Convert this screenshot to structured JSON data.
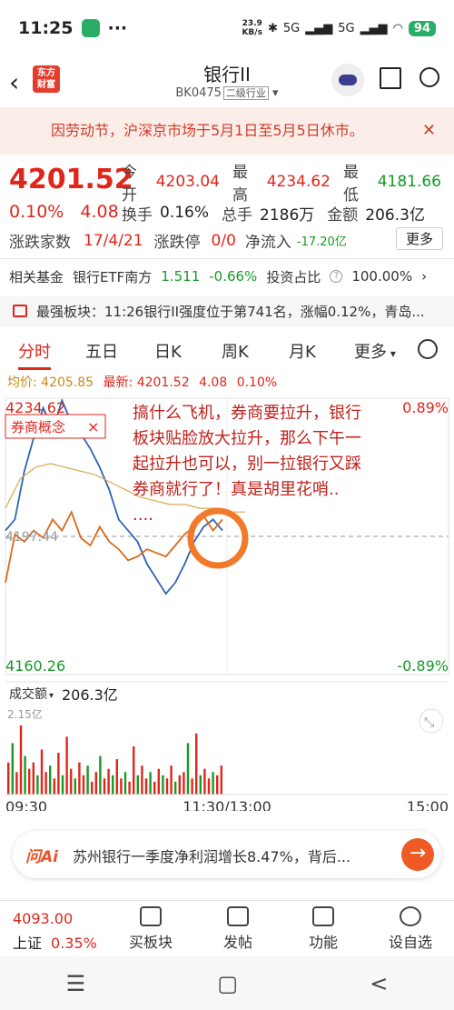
{
  "status_bar": {
    "time": "11:25",
    "more": "···",
    "net_speed_value": "23.9",
    "net_speed_unit": "KB/s",
    "signal1": "5G",
    "signal2": "5G",
    "battery": "94"
  },
  "nav": {
    "logo_line1": "东方",
    "logo_line2": "财富",
    "title": "银行II",
    "code": "BK0475",
    "category": "二级行业"
  },
  "notice": {
    "text": "因劳动节，沪深京市场于5月1日至5月5日休市。"
  },
  "quote": {
    "price": "4201.52",
    "change_pct": "0.10%",
    "change": "4.08",
    "open_label": "今开",
    "open": "4203.04",
    "high_label": "最高",
    "high": "4234.62",
    "low_label": "最低",
    "low": "4181.66",
    "turnover_label": "换手",
    "turnover": "0.16%",
    "volume_label": "总手",
    "volume": "2186万",
    "amount_label": "金额",
    "amount": "206.3亿",
    "updown_label": "涨跌家数",
    "updown": "17/4/21",
    "limit_label": "涨跌停",
    "limit": "0/0",
    "netflow_label": "净流入",
    "netflow": "-17.20亿",
    "more_label": "更多"
  },
  "fund": {
    "label": "相关基金",
    "name": "银行ETF南方",
    "price": "1.511",
    "change": "-0.66%",
    "ratio_label": "投资占比",
    "ratio": "100.00%"
  },
  "strong": {
    "text": "最强板块：11:26银行II强度位于第741名，涨幅0.12%，青岛..."
  },
  "tabs": [
    "分时",
    "五日",
    "日K",
    "周K",
    "月K",
    "更多"
  ],
  "avg": {
    "avg_label": "均价:",
    "avg_value": "4205.85",
    "latest_label": "最新:",
    "latest_value": "4201.52",
    "change": "4.08",
    "pct": "0.10%"
  },
  "chart_data": {
    "type": "line",
    "top_price_label": "4234.62",
    "bottom_price_label": "4160.26",
    "mid_price_label": "4197.44",
    "top_pct_label": "0.89%",
    "bottom_pct_label": "-0.89%",
    "overlay_tag": "券商概念",
    "overlay_close": "×",
    "annotation": "搞什么飞机，券商要拉升，银行板块贴脸放大拉升，那么下午一起拉升也可以，别一拉银行又踩券商就行了！真是胡里花哨......",
    "volume_label": "成交额",
    "volume_total": "206.3亿",
    "volume_max_label": "2.15亿",
    "time_labels": [
      "09:30",
      "11:30/13:00",
      "15:00"
    ],
    "ylim": [
      4160.26,
      4234.62
    ],
    "series": [
      {
        "values": [
          4199,
          4202,
          4215,
          4224,
          4232,
          4226,
          4234,
          4228,
          4225,
          4221,
          4216,
          4210,
          4202,
          4199,
          4196,
          4190,
          4186,
          4182,
          4185,
          4190,
          4196,
          4200,
          4202,
          4199
        ]
      },
      {
        "values": [
          4185,
          4198,
          4196,
          4199,
          4197,
          4202,
          4199,
          4204,
          4197,
          4195,
          4200,
          4196,
          4194,
          4191,
          4192,
          4194,
          4193,
          4192,
          4195,
          4198,
          4200,
          4203,
          4199,
          4202
        ]
      },
      {
        "values": [
          4205,
          4213,
          4216,
          4217,
          4216,
          4215,
          4214,
          4212,
          4210,
          4208,
          4207,
          4206,
          4206,
          4205,
          4205,
          4204,
          4204
        ]
      }
    ],
    "volume": [
      1.0,
      1.6,
      0.7,
      2.15,
      1.2,
      0.8,
      1.0,
      0.6,
      1.4,
      0.7,
      0.9,
      0.5,
      1.3,
      0.6,
      1.8,
      0.8,
      0.5,
      1.0,
      0.6,
      0.9,
      0.4,
      0.7,
      1.2,
      0.5,
      0.8,
      0.6,
      1.1,
      0.5,
      0.7,
      0.4,
      1.5,
      0.6,
      0.9,
      0.5,
      0.7,
      0.4,
      0.8,
      0.6,
      0.5,
      0.9,
      0.4,
      0.6,
      0.7,
      1.6,
      0.5,
      1.9,
      0.6,
      0.8,
      0.5,
      0.7,
      0.6,
      0.9
    ]
  },
  "ad": {
    "brand": "问Ai",
    "text": "苏州银行一季度净利润增长8.47%，背后..."
  },
  "bottom": {
    "index_value": "4093.00",
    "index_name": "上证",
    "index_pct": "0.35%",
    "items": [
      "买板块",
      "发帖",
      "功能",
      "设自选"
    ]
  },
  "sysnav": {
    "menu": "☰",
    "home": "▢",
    "back": "<"
  }
}
